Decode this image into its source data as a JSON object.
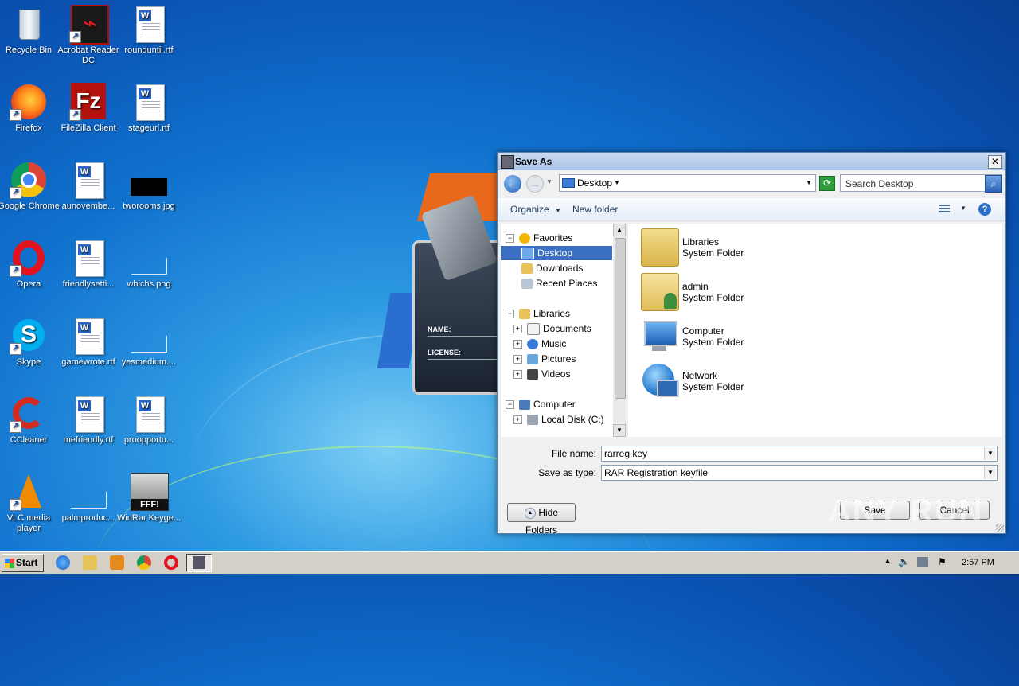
{
  "desktop": {
    "icons": [
      {
        "label": "Recycle Bin"
      },
      {
        "label": "Acrobat Reader DC"
      },
      {
        "label": "rounduntil.rtf"
      },
      {
        "label": "Firefox"
      },
      {
        "label": "FileZilla Client"
      },
      {
        "label": "stageurl.rtf"
      },
      {
        "label": "Google Chrome"
      },
      {
        "label": "aunovembe..."
      },
      {
        "label": "tworooms.jpg"
      },
      {
        "label": "Opera"
      },
      {
        "label": "friendlysetti..."
      },
      {
        "label": "whichs.png"
      },
      {
        "label": "Skype"
      },
      {
        "label": "gamewrote.rtf"
      },
      {
        "label": "yesmedium...."
      },
      {
        "label": "CCleaner"
      },
      {
        "label": "mefriendly.rtf"
      },
      {
        "label": "proopportu..."
      },
      {
        "label": "VLC media player"
      },
      {
        "label": "palmproduc..."
      },
      {
        "label": "WinRar Keyge..."
      }
    ]
  },
  "background_app": {
    "name_label": "NAME:",
    "license_label": "LICENSE:",
    "keygen_badge": "FFF!"
  },
  "dialog": {
    "title": "Save As",
    "close_glyph": "✕",
    "address": {
      "location": "Desktop"
    },
    "search": {
      "placeholder": "Search Desktop"
    },
    "toolbar": {
      "organize": "Organize",
      "new_folder": "New folder"
    },
    "nav": {
      "favorites": "Favorites",
      "desktop": "Desktop",
      "downloads": "Downloads",
      "recent_places": "Recent Places",
      "libraries": "Libraries",
      "documents": "Documents",
      "music": "Music",
      "pictures": "Pictures",
      "videos": "Videos",
      "computer": "Computer",
      "local_disk": "Local Disk (C:)"
    },
    "items": [
      {
        "name": "Libraries",
        "type": "System Folder"
      },
      {
        "name": "admin",
        "type": "System Folder"
      },
      {
        "name": "Computer",
        "type": "System Folder"
      },
      {
        "name": "Network",
        "type": "System Folder"
      }
    ],
    "file_name_label": "File name:",
    "file_name_value": "rarreg.key",
    "save_type_label": "Save as type:",
    "save_type_value": "RAR Registration keyfile",
    "hide_folders": "Hide Folders",
    "save": "Save",
    "cancel": "Cancel"
  },
  "taskbar": {
    "start": "Start",
    "clock": "2:57 PM"
  },
  "watermark": "ANY RUN",
  "colors": {
    "desktop_blue": "#1173cf",
    "selection": "#3a6fc2",
    "titlebar": "#a7c3e6"
  }
}
